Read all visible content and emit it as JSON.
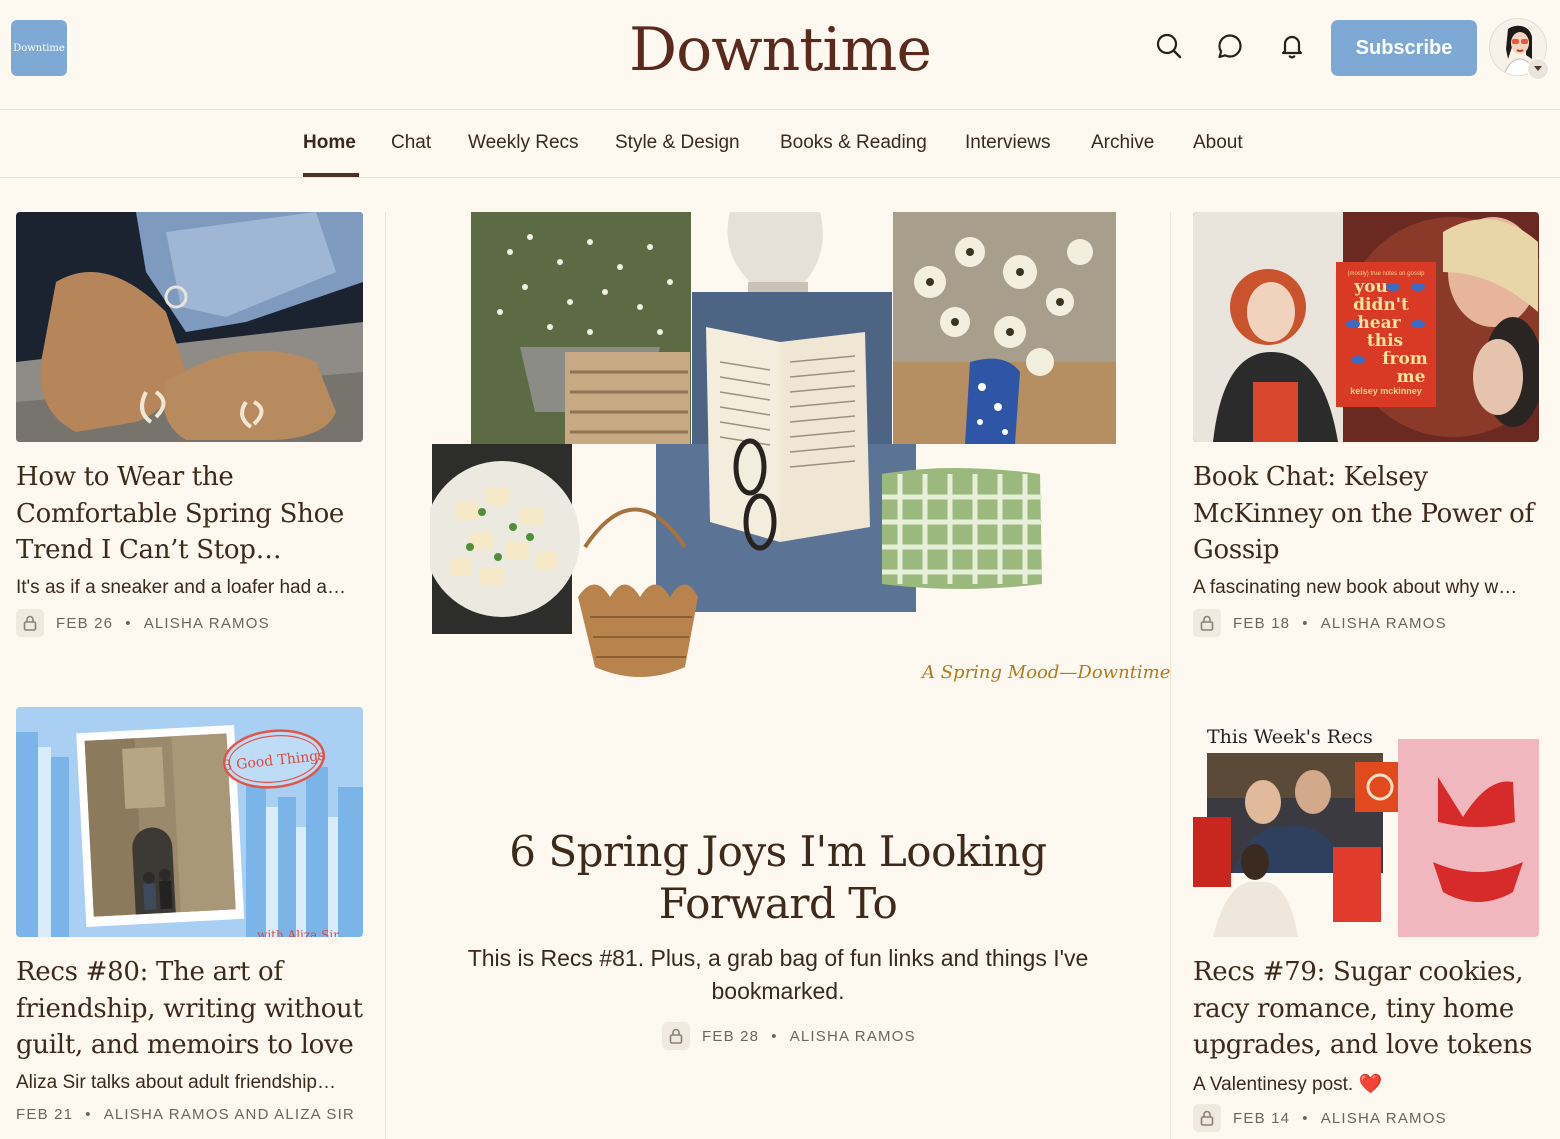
{
  "header": {
    "logo_text": "Downtime",
    "site_title": "Downtime",
    "subscribe_label": "Subscribe",
    "icons": [
      "search-icon",
      "chat-bubble-icon",
      "bell-icon"
    ],
    "accent_color": "#7ea9d4",
    "title_color": "#5a2a1e"
  },
  "nav": {
    "items": [
      {
        "label": "Home",
        "active": true
      },
      {
        "label": "Chat"
      },
      {
        "label": "Weekly Recs"
      },
      {
        "label": "Style & Design"
      },
      {
        "label": "Books & Reading"
      },
      {
        "label": "Interviews"
      },
      {
        "label": "Archive"
      },
      {
        "label": "About"
      }
    ]
  },
  "posts": {
    "left_top": {
      "title": "How to Wear the Comfortable Spring Shoe Trend I Can’t Stop…",
      "subtitle": "It's as if a sneaker and a loafer had a…",
      "date": "FEB 26",
      "author": "ALISHA RAMOS"
    },
    "left_bottom": {
      "image_text": "3 Good Things",
      "image_text_2": "with Aliza Sir",
      "title": "Recs #80: The art of friendship, writing without guilt, and memoirs to love",
      "subtitle": "Aliza Sir talks about adult friendship…",
      "date": "FEB 21",
      "author": "ALISHA RAMOS AND ALIZA SIR"
    },
    "hero": {
      "image_caption": "A Spring Mood—Downtime",
      "title": "6 Spring Joys I'm Looking Forward To",
      "subtitle": "This is Recs #81. Plus, a grab bag of fun links and things I've bookmarked.",
      "date": "FEB 28",
      "author": "ALISHA RAMOS"
    },
    "right_top": {
      "book_lines": [
        "(mostly) true notes on gossip",
        "you",
        "didn't",
        "hear",
        "this",
        "from",
        "me",
        "kelsey mckinney"
      ],
      "title": "Book Chat: Kelsey McKinney on the Power of Gossip",
      "subtitle": "A fascinating new book about why w…",
      "date": "FEB 18",
      "author": "ALISHA RAMOS"
    },
    "right_bottom": {
      "image_heading": "This Week's Recs",
      "title": "Recs #79: Sugar cookies, racy romance, tiny home upgrades, and love tokens",
      "subtitle": "A Valentinesy post. ❤️",
      "date": "FEB 14",
      "author": "ALISHA RAMOS"
    }
  },
  "meta_separator": "•"
}
